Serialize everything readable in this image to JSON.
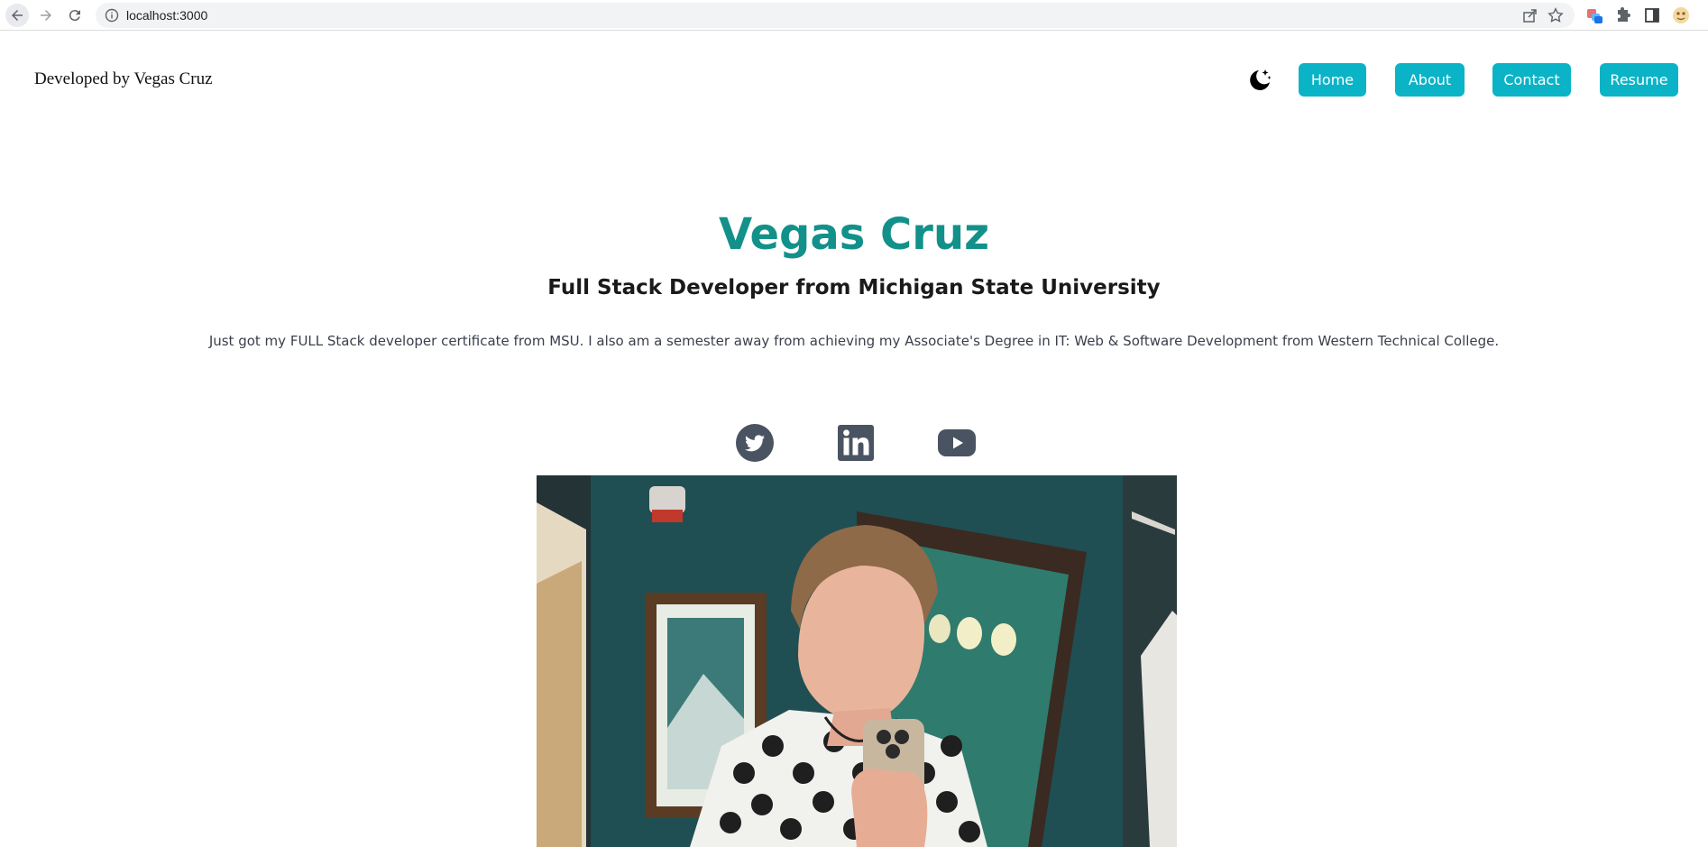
{
  "browser": {
    "url": "localhost:3000",
    "icons": [
      "back-arrow-icon",
      "forward-arrow-icon",
      "reload-icon",
      "info-icon",
      "share-icon",
      "star-icon",
      "extension-icon",
      "puzzle-icon",
      "side-panel-icon",
      "profile-avatar-icon"
    ]
  },
  "header": {
    "brand": "Developed by Vegas Cruz",
    "theme_icon": "moon-stars-icon",
    "nav": {
      "home": "Home",
      "about": "About",
      "contact": "Contact",
      "resume": "Resume"
    }
  },
  "hero": {
    "name": "Vegas Cruz",
    "subtitle": "Full Stack Developer from Michigan State University",
    "description": "Just got my FULL Stack developer certificate from MSU. I also am a semester away from achieving my Associate's Degree in IT: Web & Software Development from Western Technical College."
  },
  "social": [
    "twitter-icon",
    "linkedin-icon",
    "youtube-icon"
  ],
  "colors": {
    "accent": "#0bb3c6",
    "name": "#12918a",
    "icon": "#4a5361"
  }
}
